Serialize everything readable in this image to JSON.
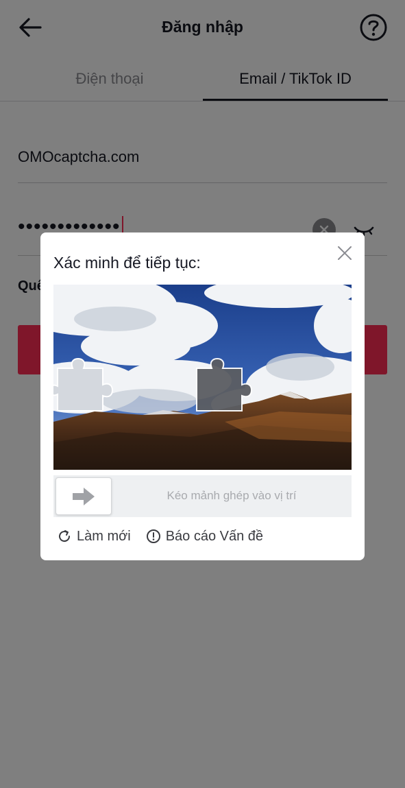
{
  "header": {
    "title": "Đăng nhập",
    "back_icon": "arrow-left-icon",
    "help_icon": "question-circle-icon"
  },
  "tabs": [
    {
      "label": "Điện thoại",
      "active": false
    },
    {
      "label": "Email / TikTok ID",
      "active": true
    }
  ],
  "form": {
    "email_value": "OMOcaptcha.com",
    "password_value": "•••••••••••••",
    "forgot_password_label": "Quê"
  },
  "captcha": {
    "title": "Xác minh để tiếp tục:",
    "slider_hint": "Kéo mảnh ghép vào vị trí",
    "refresh_label": "Làm mới",
    "report_label": "Báo cáo Vấn đề"
  },
  "colors": {
    "accent": "#fe2c55",
    "overlay": "rgba(0,0,0,0.5)"
  }
}
